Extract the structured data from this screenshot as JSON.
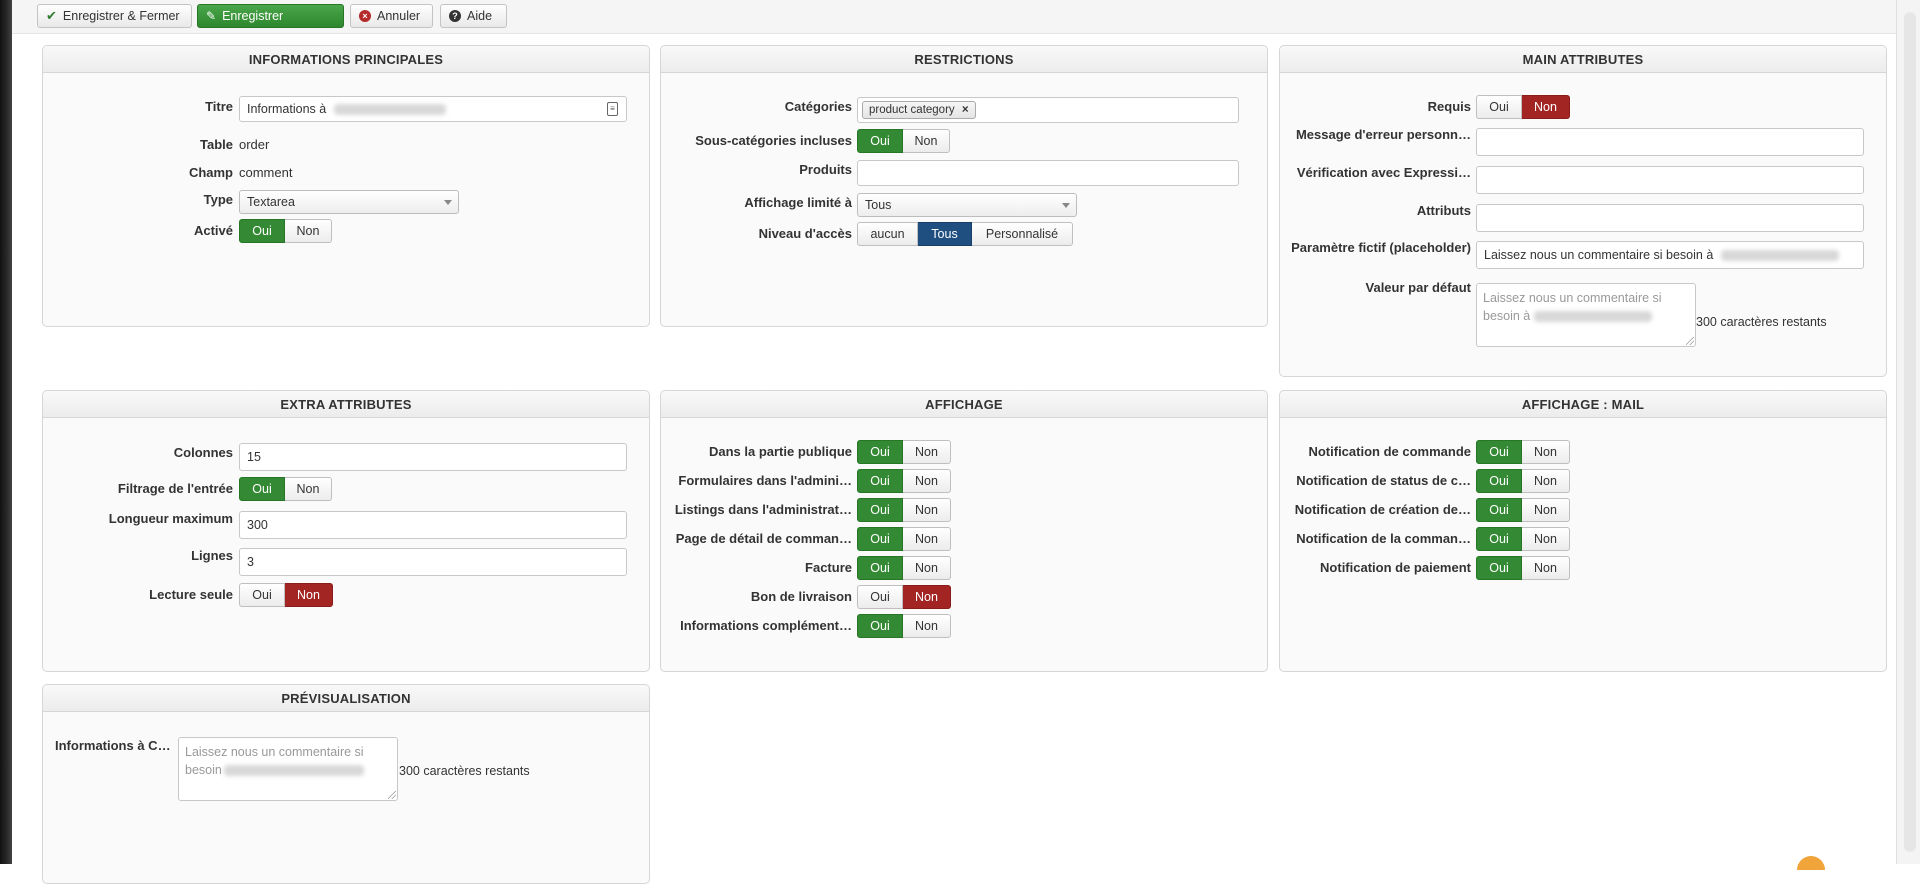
{
  "toolbar": {
    "save_close": "Enregistrer & Fermer",
    "save": "Enregistrer",
    "cancel": "Annuler",
    "help": "Aide"
  },
  "main_info": {
    "title": "INFORMATIONS PRINCIPALES",
    "titre_label": "Titre",
    "titre_value": "Informations à",
    "table_label": "Table",
    "table_value": "order",
    "champ_label": "Champ",
    "champ_value": "comment",
    "type_label": "Type",
    "type_value": "Textarea",
    "active_label": "Activé",
    "active": {
      "yes": "Oui",
      "no": "Non",
      "selected": "Oui"
    }
  },
  "restrictions": {
    "title": "RESTRICTIONS",
    "categories_label": "Catégories",
    "category_chip": "product category",
    "subcat_label": "Sous-catégories incluses",
    "subcat": {
      "yes": "Oui",
      "no": "Non",
      "selected": "Oui"
    },
    "products_label": "Produits",
    "products_value": "",
    "display_limited_label": "Affichage limité à",
    "display_limited_value": "Tous",
    "access_label": "Niveau d'accès",
    "access": {
      "none": "aucun",
      "all": "Tous",
      "custom": "Personnalisé",
      "selected": "Tous"
    }
  },
  "main_attributes": {
    "title": "MAIN ATTRIBUTES",
    "required_label": "Requis",
    "required": {
      "yes": "Oui",
      "no": "Non",
      "selected": "Non"
    },
    "error_msg_label": "Message d'erreur personn…",
    "error_msg_value": "",
    "regex_label": "Vérification avec Expressi…",
    "regex_value": "",
    "attributes_label": "Attributs",
    "attributes_value": "",
    "placeholder_label": "Paramètre fictif (placeholder)",
    "placeholder_value": "Laissez nous un commentaire si besoin à",
    "default_label": "Valeur par défaut",
    "default_placeholder_line1": "Laissez nous un commentaire si",
    "default_placeholder_line2": "besoin à",
    "default_remaining": "300 caractères restants"
  },
  "extra_attributes": {
    "title": "EXTRA ATTRIBUTES",
    "columns_label": "Colonnes",
    "columns_value": "15",
    "filter_label": "Filtrage de l'entrée",
    "filter": {
      "yes": "Oui",
      "no": "Non",
      "selected": "Oui"
    },
    "maxlen_label": "Longueur maximum",
    "maxlen_value": "300",
    "rows_label": "Lignes",
    "rows_value": "3",
    "readonly_label": "Lecture seule",
    "readonly": {
      "yes": "Oui",
      "no": "Non",
      "selected": "Non"
    }
  },
  "display": {
    "title": "AFFICHAGE",
    "items": [
      {
        "label": "Dans la partie publique",
        "yes": "Oui",
        "no": "Non",
        "selected": "Oui"
      },
      {
        "label": "Formulaires dans l'admini…",
        "yes": "Oui",
        "no": "Non",
        "selected": "Oui"
      },
      {
        "label": "Listings dans l'administrat…",
        "yes": "Oui",
        "no": "Non",
        "selected": "Oui"
      },
      {
        "label": "Page de détail de comman…",
        "yes": "Oui",
        "no": "Non",
        "selected": "Oui"
      },
      {
        "label": "Facture",
        "yes": "Oui",
        "no": "Non",
        "selected": "Oui"
      },
      {
        "label": "Bon de livraison",
        "yes": "Oui",
        "no": "Non",
        "selected": "Non"
      },
      {
        "label": "Informations complément…",
        "yes": "Oui",
        "no": "Non",
        "selected": "Oui"
      }
    ]
  },
  "display_mail": {
    "title": "AFFICHAGE : MAIL",
    "items": [
      {
        "label": "Notification de commande",
        "yes": "Oui",
        "no": "Non",
        "selected": "Oui"
      },
      {
        "label": "Notification de status de c…",
        "yes": "Oui",
        "no": "Non",
        "selected": "Oui"
      },
      {
        "label": "Notification de création de…",
        "yes": "Oui",
        "no": "Non",
        "selected": "Oui"
      },
      {
        "label": "Notification de la comman…",
        "yes": "Oui",
        "no": "Non",
        "selected": "Oui"
      },
      {
        "label": "Notification de paiement",
        "yes": "Oui",
        "no": "Non",
        "selected": "Oui"
      }
    ]
  },
  "preview": {
    "title": "PRÉVISUALISATION",
    "field_label": "Informations à C…",
    "placeholder_line1": "Laissez nous un commentaire si",
    "placeholder_line2": "besoin",
    "remaining": "300 caractères restants"
  },
  "colors": {
    "green": "#348a34",
    "red": "#a32523",
    "blue": "#1e4f80"
  },
  "icons": {
    "save_close": "check-icon",
    "save": "edit-icon",
    "cancel": "cancel-circle-icon",
    "help": "question-circle-icon",
    "chip_remove": "close-icon",
    "field_tool": "document-icon"
  }
}
